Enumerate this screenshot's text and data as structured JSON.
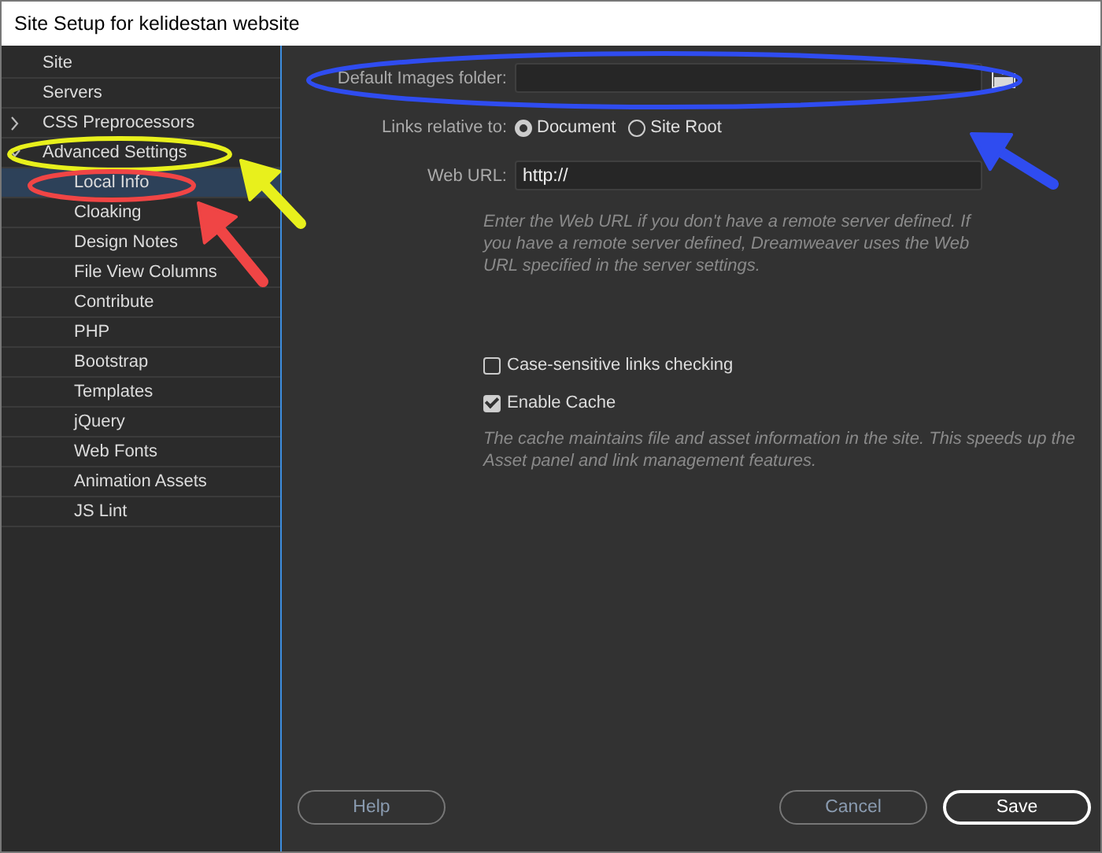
{
  "window": {
    "title": "Site Setup for kelidestan website"
  },
  "sidebar": {
    "items": [
      {
        "label": "Site",
        "selected": false
      },
      {
        "label": "Servers",
        "selected": false
      },
      {
        "label": "CSS Preprocessors",
        "selected": false,
        "expanded": false
      },
      {
        "label": "Advanced Settings",
        "selected": false,
        "expanded": true,
        "children": [
          {
            "label": "Local Info",
            "selected": true
          },
          {
            "label": "Cloaking",
            "selected": false
          },
          {
            "label": "Design Notes",
            "selected": false
          },
          {
            "label": "File View Columns",
            "selected": false
          },
          {
            "label": "Contribute",
            "selected": false
          },
          {
            "label": "PHP",
            "selected": false
          },
          {
            "label": "Bootstrap",
            "selected": false
          },
          {
            "label": "Templates",
            "selected": false
          },
          {
            "label": "jQuery",
            "selected": false
          },
          {
            "label": "Web Fonts",
            "selected": false
          },
          {
            "label": "Animation Assets",
            "selected": false
          },
          {
            "label": "JS Lint",
            "selected": false
          }
        ]
      }
    ]
  },
  "form": {
    "images_folder": {
      "label": "Default Images folder:"
    },
    "links_relative": {
      "label": "Links relative to:",
      "options": [
        {
          "label": "Document",
          "selected": true
        },
        {
          "label": "Site Root",
          "selected": false
        }
      ]
    },
    "web_url": {
      "label": "Web URL:",
      "value": "http://"
    },
    "web_url_hint": "Enter the Web URL if you don't have a remote server defined. If you have a remote server defined, Dreamweaver uses the Web URL specified in the server settings.",
    "checkboxes": [
      {
        "label": "Case-sensitive links checking",
        "checked": false
      },
      {
        "label": "Enable Cache",
        "checked": true
      }
    ],
    "cache_hint": "The cache maintains file and asset information in the site. This speeds up the Asset panel and link management features."
  },
  "buttons": [
    {
      "label": "Help",
      "kind": "secondary"
    },
    {
      "label": "Cancel",
      "kind": "secondary"
    },
    {
      "label": "Save",
      "kind": "primary"
    }
  ],
  "annotations": [
    {
      "kind": "ellipse",
      "color": "#2f4cf0"
    },
    {
      "kind": "arrow",
      "color": "#2f4cf0"
    },
    {
      "kind": "ellipse",
      "color": "#e8f01c"
    },
    {
      "kind": "arrow",
      "color": "#e8f01c"
    },
    {
      "kind": "ellipse",
      "color": "#f04545"
    },
    {
      "kind": "arrow",
      "color": "#f04545"
    }
  ]
}
